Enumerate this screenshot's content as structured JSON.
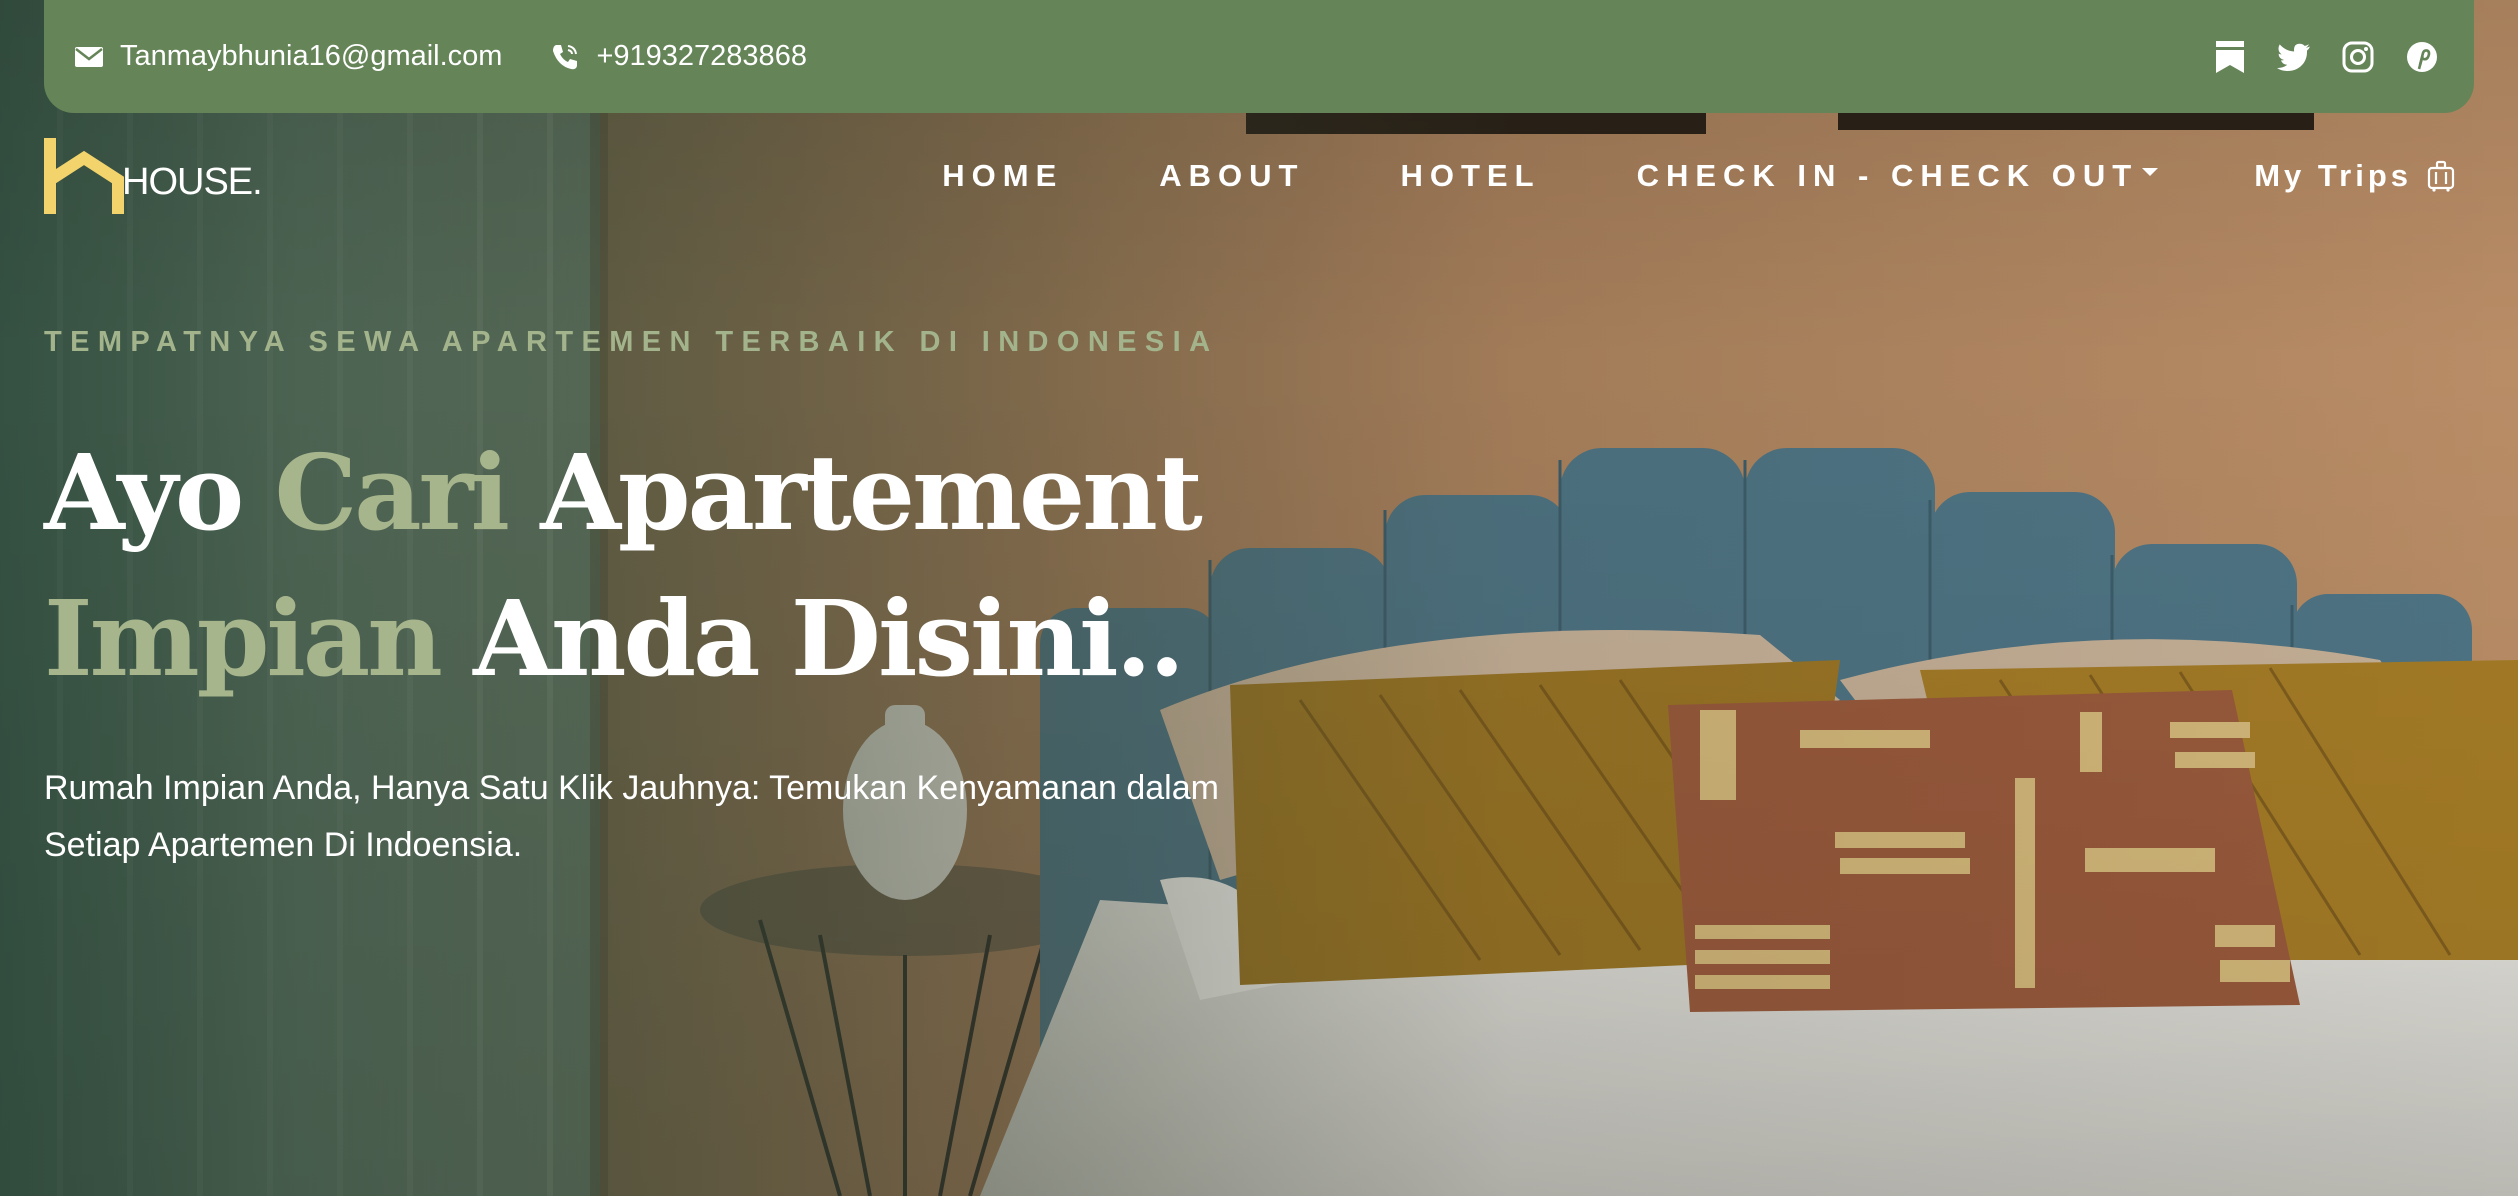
{
  "topbar": {
    "email": "Tanmaybhunia16@gmail.com",
    "phone": "+919327283868",
    "icons": [
      "mail-icon",
      "phone-icon",
      "bookmark-icon",
      "twitter-icon",
      "instagram-icon",
      "pinterest-icon"
    ]
  },
  "brand": {
    "name": "HOUSE."
  },
  "nav": {
    "items": [
      {
        "label": "HOME"
      },
      {
        "label": "ABOUT"
      },
      {
        "label": "HOTEL"
      },
      {
        "label": "CHECK IN - CHECK OUT"
      },
      {
        "label": "My Trips"
      }
    ]
  },
  "hero": {
    "eyebrow": "TEMPATNYA SEWA APARTEMEN TERBAIK DI INDONESIA",
    "headline": {
      "w1": "Ayo",
      "w2": "Cari",
      "w3": "Apartement",
      "w4": "Impian",
      "w5": "Anda Disini.."
    },
    "subtitle": "Rumah Impian Anda, Hanya Satu Klik Jauhnya: Temukan Kenyamanan dalam Setiap Apartemen Di Indoensia."
  },
  "colors": {
    "topbar": "#658458",
    "accent_text": "#a6b58c",
    "logo_mark": "#f3d36b",
    "text": "#ffffff"
  }
}
